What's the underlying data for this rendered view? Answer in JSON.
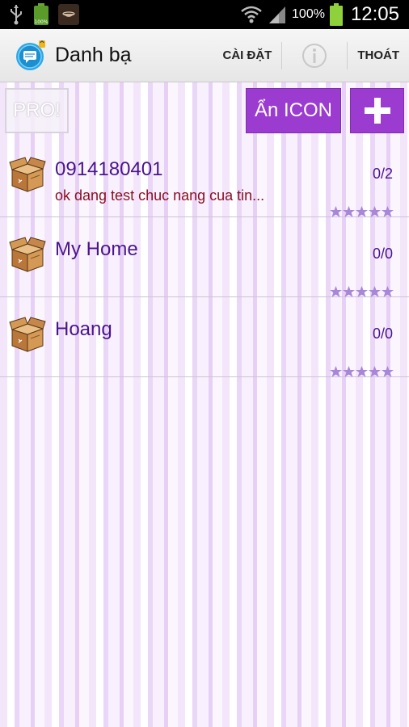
{
  "status_bar": {
    "battery_percent": "100%",
    "time": "12:05"
  },
  "action_bar": {
    "title": "Danh bạ",
    "settings_label": "CÀI ĐẶT",
    "exit_label": "THOÁT",
    "icons": [
      "chat-logo-icon",
      "info-icon"
    ]
  },
  "toolbar": {
    "pro_label": "PRO!",
    "hide_icon_label": "Ẩn ICON"
  },
  "contacts": [
    {
      "name": "0914180401",
      "message": "ok dang test chuc nang cua tin...",
      "count": "0/2",
      "rating": 5
    },
    {
      "name": "My Home",
      "message": "",
      "count": "0/0",
      "rating": 5
    },
    {
      "name": "Hoang",
      "message": "",
      "count": "0/0",
      "rating": 5
    }
  ],
  "colors": {
    "accent": "#9b3bd0",
    "name_text": "#4a148c",
    "message_text": "#8b0f24",
    "star": "#a886d8"
  }
}
